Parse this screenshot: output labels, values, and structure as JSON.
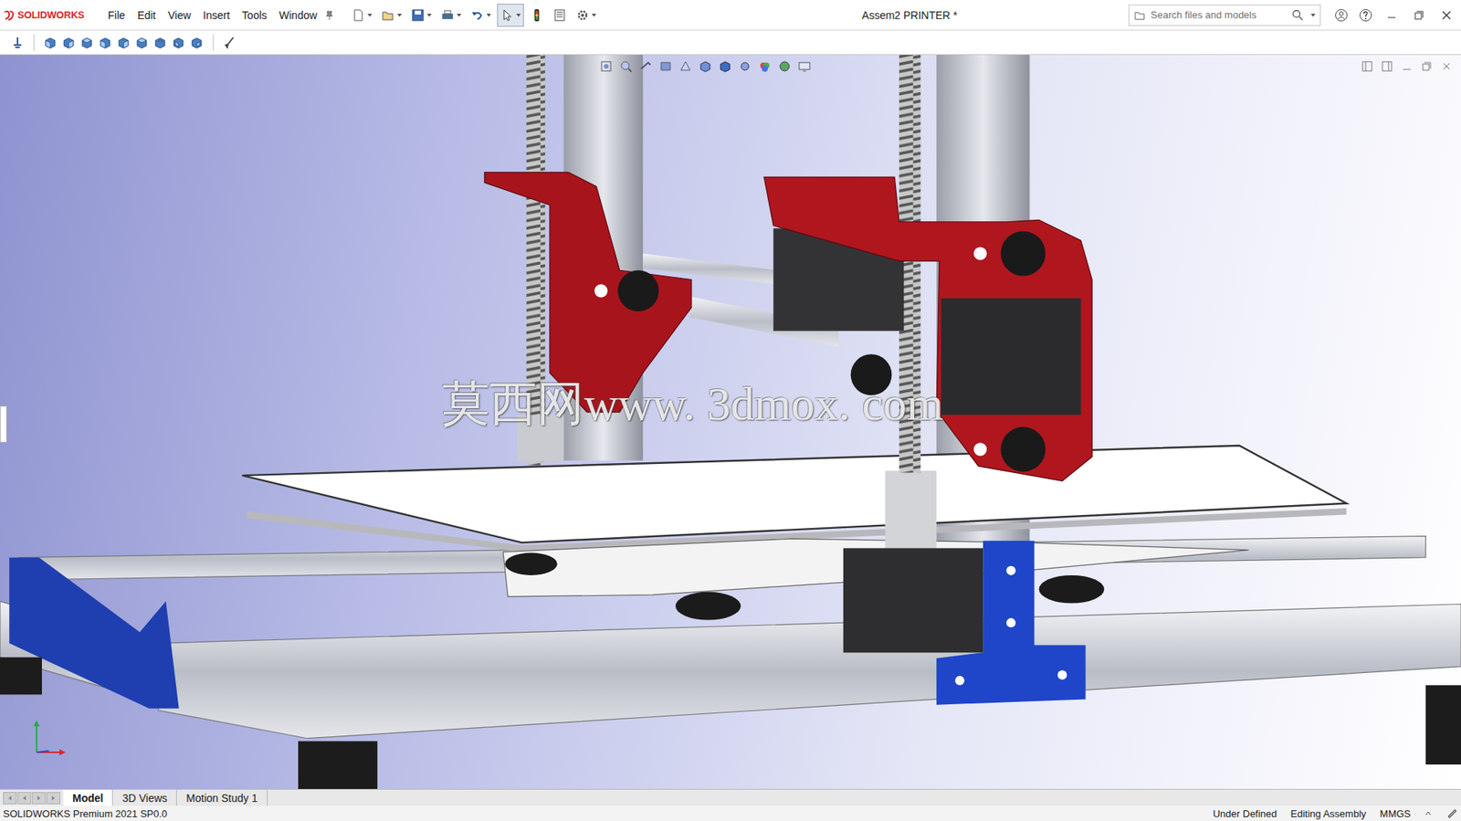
{
  "window": {
    "title": "Assem2 PRINTER *",
    "app": "SOLIDWORKS"
  },
  "menu": [
    "File",
    "Edit",
    "View",
    "Insert",
    "Tools",
    "Window"
  ],
  "search": {
    "placeholder": "Search files and models"
  },
  "viewport": {
    "watermark": "莫西网www. 3dmox. com"
  },
  "tabs": [
    {
      "label": "Model",
      "selected": true
    },
    {
      "label": "3D Views",
      "selected": false
    },
    {
      "label": "Motion Study 1",
      "selected": false
    }
  ],
  "status_bar": {
    "product": "SOLIDWORKS Premium 2021 SP0.0",
    "items": [
      "Under Defined",
      "Editing Assembly",
      "MMGS"
    ]
  }
}
